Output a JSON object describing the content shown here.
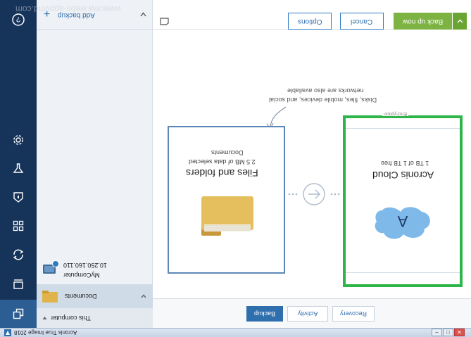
{
  "window": {
    "title": "Acronis True Image 2018",
    "watermark": "www.ww.webs-appvmd.com"
  },
  "nav": {
    "items": [
      {
        "icon": "help-icon"
      },
      {
        "icon": "gear-icon"
      },
      {
        "icon": "funnel-icon"
      },
      {
        "icon": "shield-icon"
      },
      {
        "icon": "grid-icon"
      },
      {
        "icon": "sync-icon"
      },
      {
        "icon": "monitor-icon"
      },
      {
        "icon": "copy-icon"
      }
    ]
  },
  "backup_list": {
    "add_label": "Add backup",
    "group_label": "This computer",
    "selected_item": "Documents",
    "item": {
      "name": "MyComputer",
      "address": "10.250.160.110"
    }
  },
  "toolbar": {
    "options_label": "Options",
    "cancel_label": "Cancel",
    "backup_now_label": "Back up now"
  },
  "source": {
    "title": "Files and folders",
    "subtitle": "2.5 MB of data selected",
    "detail": "Documents"
  },
  "destination": {
    "title": "Acronis Cloud",
    "subtitle": "1 TB of 1 TB free",
    "encryption_hint": "Encryption"
  },
  "hint": {
    "line1": "Disks, files, mobile devices, and social",
    "line2": "networks are also available"
  },
  "tabs": [
    {
      "label": "Backup"
    },
    {
      "label": "Activity"
    },
    {
      "label": "Recovery"
    }
  ],
  "colors": {
    "nav_bg": "#16335a",
    "accent_blue": "#2f6fae",
    "green": "#7cb342",
    "highlight": "#2db54a"
  }
}
